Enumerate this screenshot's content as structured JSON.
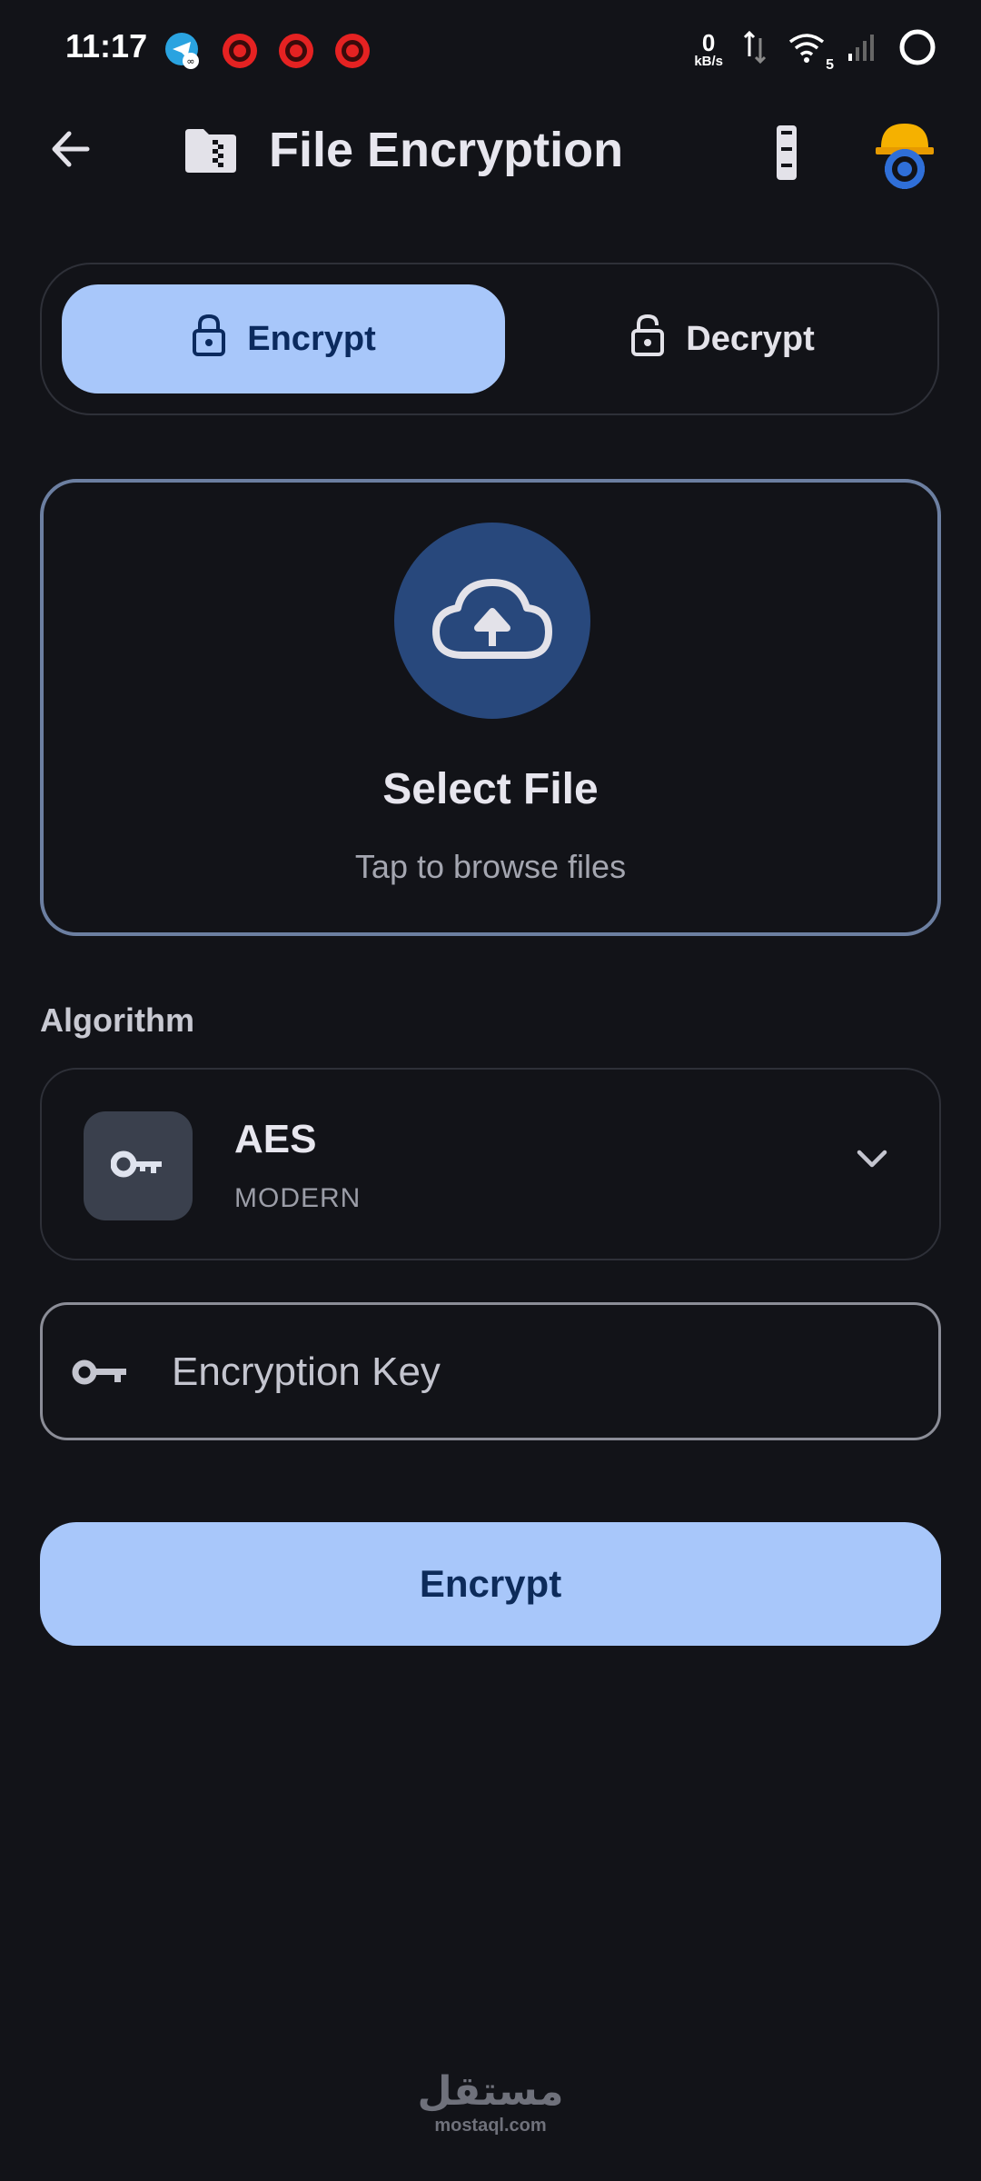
{
  "status_bar": {
    "time": "11:17",
    "net_speed": "0",
    "net_unit": "kB/s",
    "wifi_label": "5",
    "notification_icons": [
      "telegram-icon",
      "brawl-stars-icon",
      "brawl-stars-icon",
      "brawl-stars-icon"
    ]
  },
  "app_bar": {
    "title": "File Encryption"
  },
  "mode_toggle": {
    "encrypt_label": "Encrypt",
    "decrypt_label": "Decrypt",
    "active": "encrypt"
  },
  "upload": {
    "title": "Select File",
    "subtitle": "Tap to browse files"
  },
  "algorithm": {
    "section_label": "Algorithm",
    "selected_name": "AES",
    "selected_type": "MODERN"
  },
  "key_field": {
    "placeholder": "Encryption Key",
    "value": ""
  },
  "primary_button": {
    "label": "Encrypt"
  },
  "watermark": {
    "arabic": "مستقل",
    "latin": "mostaql.com"
  },
  "colors": {
    "background": "#121318",
    "accent": "#a8c7fa",
    "accent_text": "#0b2a5e",
    "upload_circle": "#28487c",
    "upload_border": "#6c7fa1"
  }
}
